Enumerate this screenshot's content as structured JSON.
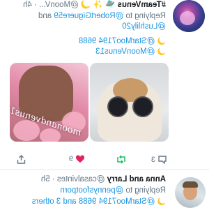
{
  "tweets": [
    {
      "display_name": "#TeamVenus",
      "name_emoji": "🛸 ✨ 🌙",
      "handle": "@MoonV...",
      "time": "· 4h",
      "reply_prefix": "Replying to",
      "reply_to_1": "@RobertGiguere59",
      "reply_and": "and",
      "reply_to_2": "@Lushlily20",
      "mention_1": "@StarMoo7194 9688",
      "mention_2": "@MoonVenus13",
      "watermark": "moonandvenus13",
      "counts": {
        "replies": "3",
        "retweets": "",
        "likes": "9"
      }
    },
    {
      "display_name": "Anna and Larry",
      "handle": "@casalvintes",
      "time": "· 5h",
      "reply_prefix": "Replying to",
      "reply_to_1": "@pennysfootporn",
      "mention_line": "@StarMoo7194 9688 and 3 others"
    }
  ],
  "colors": {
    "link": "#1b95e0",
    "retweet_active": "#17bf63",
    "like": "#e0245e",
    "muted": "#657786"
  },
  "icons": [
    "reply-icon",
    "retweet-icon",
    "like-icon",
    "share-icon",
    "moon-icon"
  ]
}
